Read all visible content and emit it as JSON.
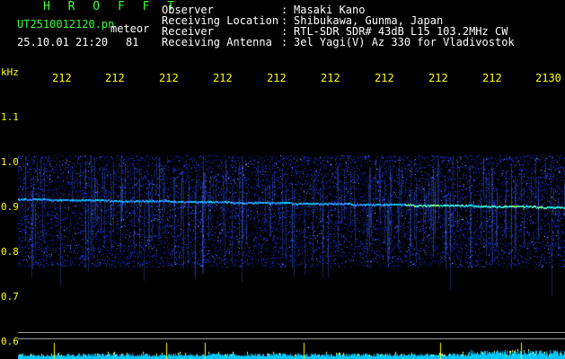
{
  "header": {
    "app_title": "H R O F F T",
    "filename": "UT2510012120.pn",
    "mode": "meteor",
    "datetime": "25.10.01 21:20",
    "count": "81",
    "fields": [
      {
        "label": "Observer",
        "sep": ":",
        "value": "Masaki Kano"
      },
      {
        "label": "Receiving Location",
        "sep": ":",
        "value": "Shibukawa, Gunma, Japan"
      },
      {
        "label": "Receiver",
        "sep": ":",
        "value": "RTL-SDR SDR# 43dB L15 103.2MHz CW"
      },
      {
        "label": "Receiving Antenna",
        "sep": ":",
        "value": "3el Yagi(V) Az 330 for Vladivostok"
      }
    ]
  },
  "axes": {
    "y_unit": "kHz",
    "y_ticks": [
      "1.1",
      "1.0",
      "0.9",
      "0.8",
      "0.7",
      "0.6"
    ],
    "x_ticks": [
      "212",
      "212",
      "212",
      "212",
      "212",
      "212",
      "212",
      "212",
      "212",
      "2130"
    ]
  },
  "colors": {
    "background": "#000000",
    "header_green": "#39ff39",
    "header_white": "#ffffff",
    "axis_yellow": "#ffff00",
    "noise_blue": "#1a2cff",
    "signal_cyan": "#00d8ff",
    "frame_gray": "#9a9a9a"
  }
}
